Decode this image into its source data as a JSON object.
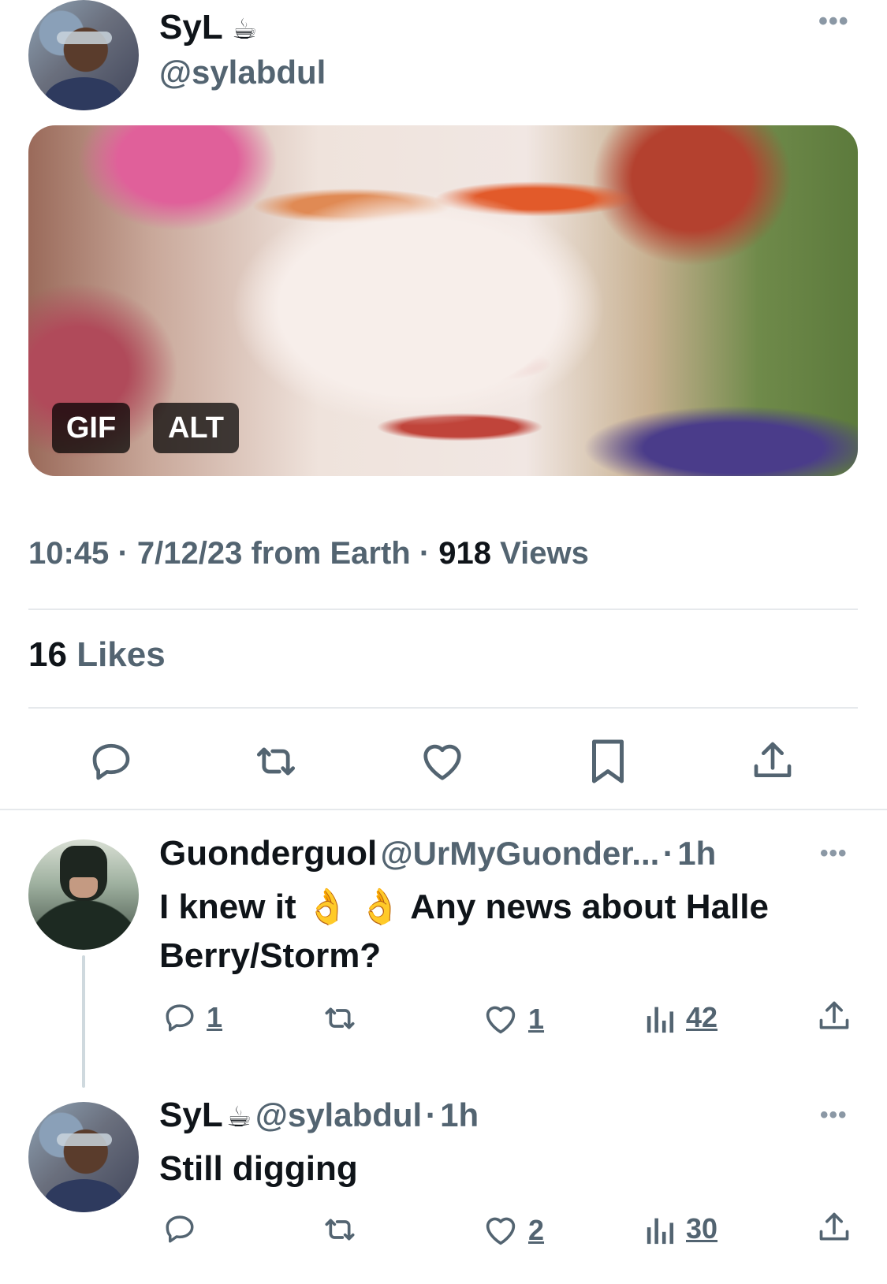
{
  "tweet": {
    "author_name": "SyL",
    "author_emoji": "☕",
    "author_handle": "@sylabdul",
    "media_badges": {
      "gif": "GIF",
      "alt": "ALT"
    },
    "time": "10:45",
    "date": "7/12/23",
    "source": "from Earth",
    "views_count": "918",
    "views_label": "Views",
    "likes_count": "16",
    "likes_label": "Likes"
  },
  "action_bar": {
    "icons": [
      "reply-icon",
      "retweet-icon",
      "like-icon",
      "bookmark-icon",
      "share-icon"
    ]
  },
  "replies": [
    {
      "name": "Guonderguol",
      "handle": "@UrMyGuonder...",
      "separator": "·",
      "time": "1h",
      "text_line1": "I knew it 👌 👌 Any news about Halle",
      "text_line2": "Berry/Storm?",
      "reply_count": "1",
      "retweet_count": "",
      "like_count": "1",
      "views_count": "42"
    },
    {
      "name": "SyL",
      "emoji": "☕",
      "handle": "@sylabdul",
      "separator": "·",
      "time": "1h",
      "text_line1": "Still digging",
      "reply_count": "",
      "retweet_count": "",
      "like_count": "2",
      "views_count": "30"
    }
  ],
  "colors": {
    "text_primary": "#0f1419",
    "text_secondary": "#536471",
    "divider": "#e6e9ec",
    "thread_line": "#cfd9de"
  }
}
